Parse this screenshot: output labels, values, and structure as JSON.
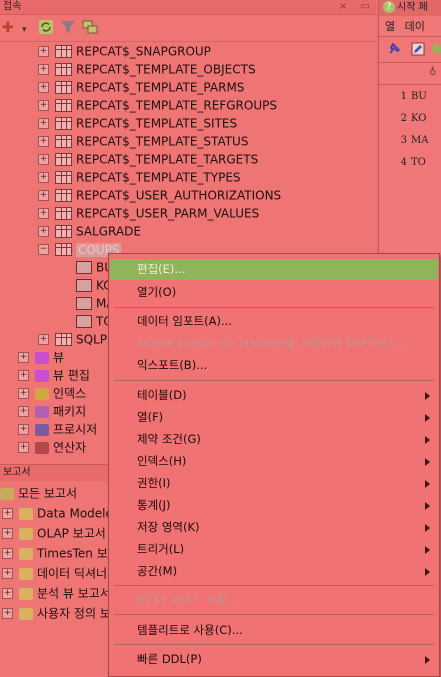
{
  "connections_panel": {
    "title": "접속",
    "header_icons": [
      "×",
      "▭"
    ]
  },
  "tree": {
    "tables": [
      {
        "label": "REPCAT$_SNAPGROUP"
      },
      {
        "label": "REPCAT$_TEMPLATE_OBJECTS"
      },
      {
        "label": "REPCAT$_TEMPLATE_PARMS"
      },
      {
        "label": "REPCAT$_TEMPLATE_REFGROUPS"
      },
      {
        "label": "REPCAT$_TEMPLATE_SITES"
      },
      {
        "label": "REPCAT$_TEMPLATE_STATUS"
      },
      {
        "label": "REPCAT$_TEMPLATE_TARGETS"
      },
      {
        "label": "REPCAT$_TEMPLATE_TYPES"
      },
      {
        "label": "REPCAT$_USER_AUTHORIZATIONS"
      },
      {
        "label": "REPCAT$_USER_PARM_VALUES"
      },
      {
        "label": "SALGRADE"
      }
    ],
    "expanded_table": {
      "label": "COUPS"
    },
    "columns": [
      {
        "label": "BU"
      },
      {
        "label": "KO"
      },
      {
        "label": "MA"
      },
      {
        "label": "TO"
      }
    ],
    "after_table": {
      "label": "SQLPL"
    },
    "folders": [
      {
        "label": "뷰",
        "color": "#c84fd0"
      },
      {
        "label": "뷰 편집",
        "color": "#c84fd0"
      },
      {
        "label": "인덱스",
        "color": "#d2a640"
      },
      {
        "label": "패키지",
        "color": "#b060b0"
      },
      {
        "label": "프로시저",
        "color": "#7a5aa0"
      },
      {
        "label": "연산자",
        "color": "#b34848"
      }
    ]
  },
  "reports_panel": {
    "title": "보고서",
    "items": [
      {
        "label": "모든 보고서"
      },
      {
        "label": "Data Modeler"
      },
      {
        "label": "OLAP 보고서"
      },
      {
        "label": "TimesTen 보"
      },
      {
        "label": "데이터 딕셔너"
      },
      {
        "label": "분석 뷰 보고서"
      },
      {
        "label": "사용자 정의 보"
      }
    ]
  },
  "start_panel": {
    "tab_label": "시작 페",
    "subtabs": [
      "열",
      "데이"
    ],
    "row_numbers": [
      "1",
      "2",
      "3",
      "4"
    ],
    "row_values": [
      "BU",
      "KO",
      "MA",
      "TO"
    ]
  },
  "context_menu": {
    "items": [
      {
        "label": "편집(E)...",
        "highlight": true
      },
      {
        "label": "열기(O)"
      },
      {
        "label": "데이터 임포트(A)..."
      },
      {
        "label": "Oracle Loader for Hadoop를 사용하여 임포트(S)...",
        "disabled": true
      },
      {
        "label": "익스포트(B)..."
      },
      {
        "label": "테이블(D)",
        "submenu": true
      },
      {
        "label": "열(F)",
        "submenu": true
      },
      {
        "label": "제약 조건(G)",
        "submenu": true
      },
      {
        "label": "인덱스(H)",
        "submenu": true
      },
      {
        "label": "권한(I)",
        "submenu": true
      },
      {
        "label": "통계(J)",
        "submenu": true
      },
      {
        "label": "저장 영역(K)",
        "submenu": true
      },
      {
        "label": "트리거(L)",
        "submenu": true
      },
      {
        "label": "공간(M)",
        "submenu": true
      },
      {
        "label": "REST 서비스 사용...",
        "disabled": true
      },
      {
        "label": "템플리트로 사용(C)..."
      },
      {
        "label": "빠른 DDL(P)",
        "submenu": true
      }
    ]
  }
}
